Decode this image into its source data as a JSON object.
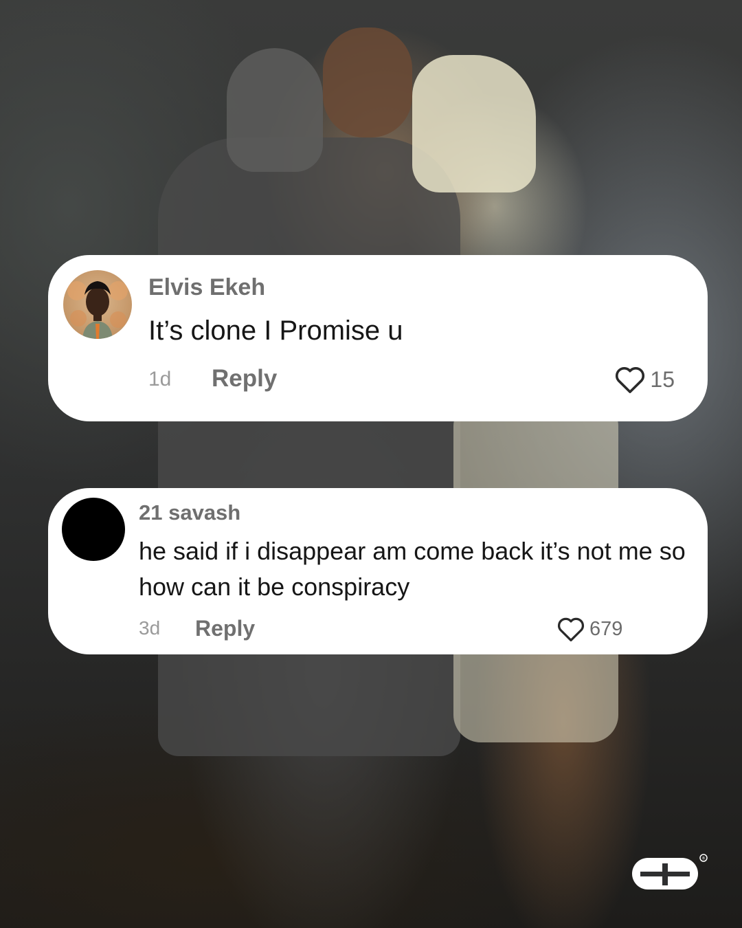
{
  "comments": [
    {
      "username": "Elvis Ekeh",
      "text": "It’s clone I Promise u",
      "time": "1d",
      "reply_label": "Reply",
      "likes": "15",
      "avatar_icon": "person-portrait-avatar"
    },
    {
      "username": "21 savash",
      "text": "he said if i disappear am come back it’s not me so how can it be conspiracy",
      "time": "3d",
      "reply_label": "Reply",
      "likes": "679",
      "avatar_icon": "black-circle-avatar"
    }
  ],
  "watermark": {
    "icon": "brand-logo-icon",
    "mark": "®"
  },
  "colors": {
    "card_bg": "#ffffff",
    "username": "#6f6f6f",
    "comment_text": "#161616",
    "meta_text": "#9a9a9a"
  }
}
